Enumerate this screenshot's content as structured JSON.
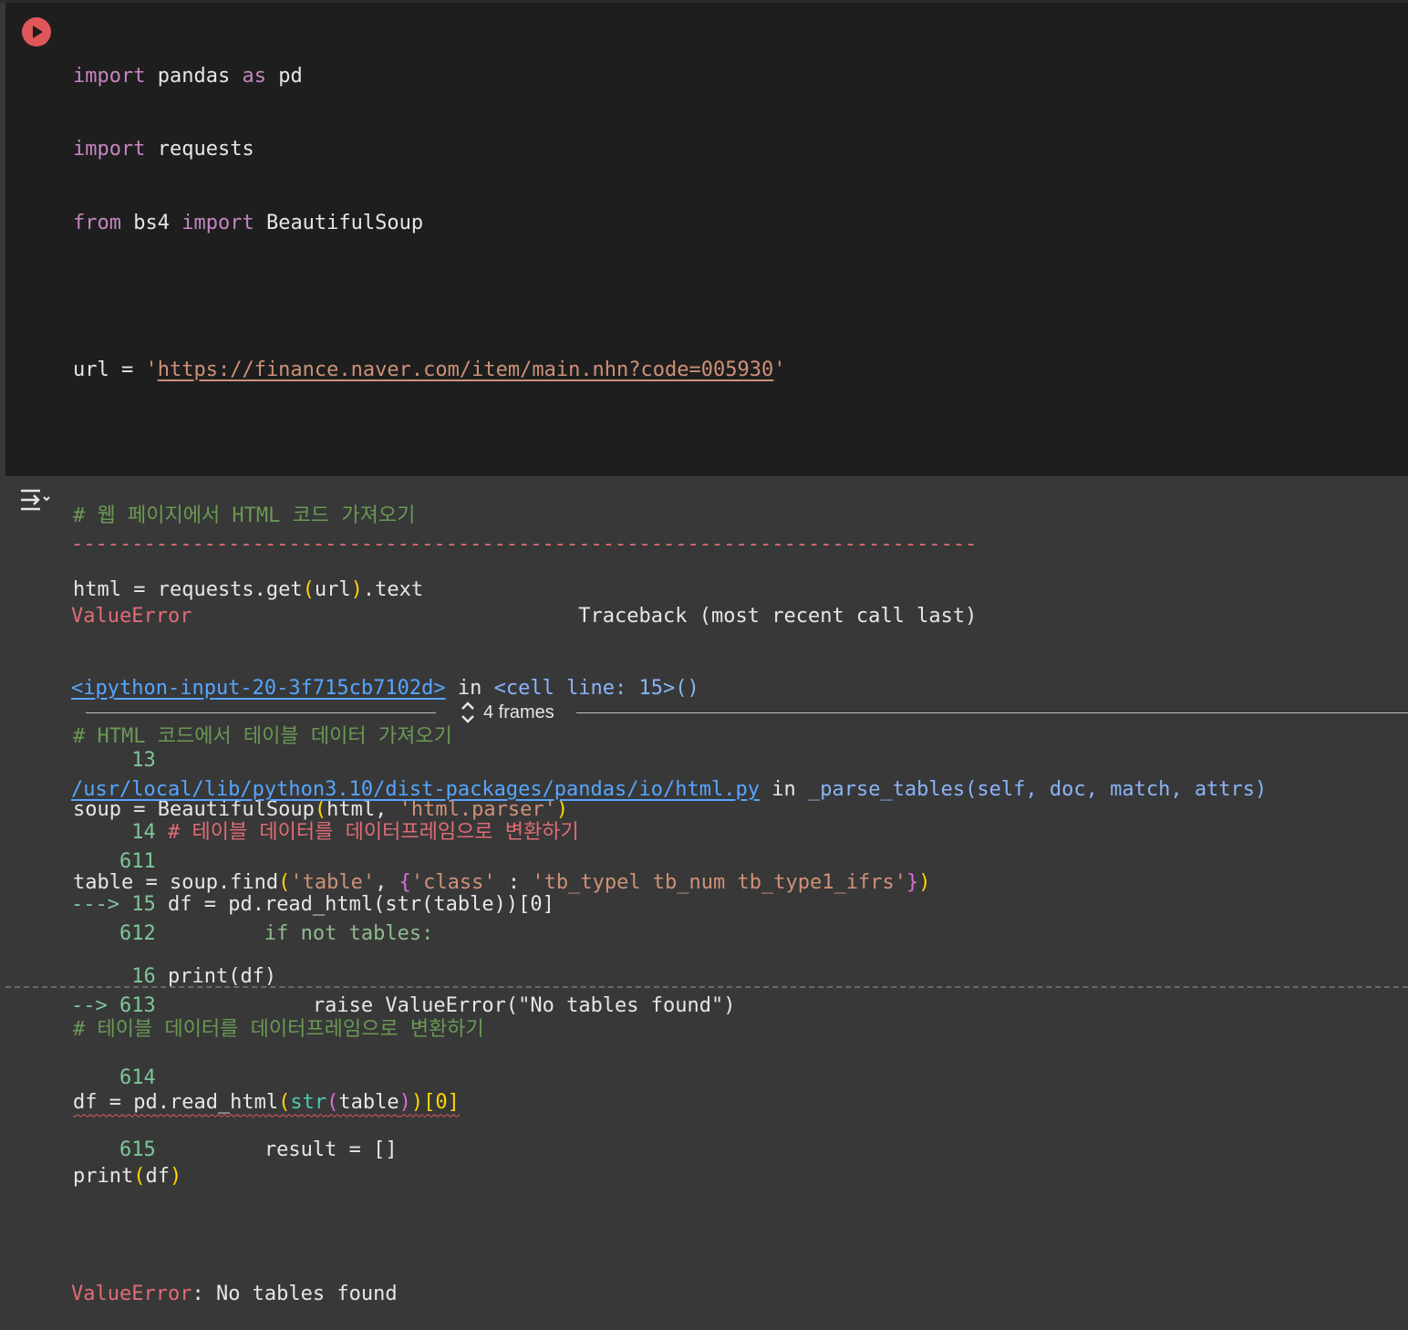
{
  "code_cell": {
    "run_button": "run-cell-icon",
    "lines": {
      "l1_kw": "import",
      "l1_rest": " pandas ",
      "l1_as": "as",
      "l1_tail": " pd",
      "l2_kw": "import",
      "l2_rest": " requests",
      "l3_from": "from",
      "l3_mod": " bs4 ",
      "l3_import": "import",
      "l3_tail": " BeautifulSoup",
      "l5_head": "url = ",
      "l5_q1": "'",
      "l5_url": "https://finance.naver.com/item/main.nhn?code=005930",
      "l5_q2": "'",
      "l7_comment": "# 웹 페이지에서 HTML 코드 가져오기",
      "l8_head": "html = requests.get",
      "l8_open": "(",
      "l8_arg": "url",
      "l8_close": ")",
      "l8_tail": ".text",
      "l10_comment": "# HTML 코드에서 테이블 데이터 가져오기",
      "l11_head": "soup = BeautifulSoup",
      "l11_open": "(",
      "l11_mid": "html, ",
      "l11_str": "'html.parser'",
      "l11_close": ")",
      "l12_head": "table = soup.find",
      "l12_open": "(",
      "l12_s1": "'table'",
      "l12_comma": ", ",
      "l12_bo": "{",
      "l12_s2": "'class'",
      "l12_colon": " : ",
      "l12_s3": "'tb_typel tb_num tb_type1_ifrs'",
      "l12_bc": "}",
      "l12_close": ")",
      "l14_comment": "# 테이블 데이터를 데이터프레임으로 변환하기",
      "l15_head": "df = pd.read_html",
      "l15_o1": "(",
      "l15_str": "str",
      "l15_o2": "(",
      "l15_arg": "table",
      "l15_c2": ")",
      "l15_c1": ")",
      "l15_idx": "[0]",
      "l16_head": "print",
      "l16_open": "(",
      "l16_arg": "df",
      "l16_close": ")"
    }
  },
  "output": {
    "icon": "output-toggle-icon",
    "dashes": "---------------------------------------------------------------------------",
    "error_name": "ValueError",
    "traceback_header": "Traceback (most recent call last)",
    "frame1": {
      "link": "<ipython-input-20-3f715cb7102d>",
      "in_text": " in ",
      "location": "<cell line: 15>()",
      "lines": [
        {
          "num": "     13",
          "code": ""
        },
        {
          "num": "     14",
          "code": "# 테이블 데이터를 데이터프레임으로 변환하기"
        },
        {
          "arrow": "---> ",
          "num": "15",
          "code": "df = pd.read_html(str(table))[0]"
        },
        {
          "num": "     16",
          "code": "print(df)"
        }
      ]
    },
    "frames_label": "4 frames",
    "frame2": {
      "link": "/usr/local/lib/python3.10/dist-packages/pandas/io/html.py",
      "in_text": " in ",
      "func": "_parse_tables(self, doc, match, attrs)",
      "lines": [
        {
          "num": "    611",
          "code": ""
        },
        {
          "num": "    612",
          "code": "        if not tables:"
        },
        {
          "arrow": "--> ",
          "num": "613",
          "code": "            raise ValueError(\"No tables found\")"
        },
        {
          "num": "    614",
          "code": ""
        },
        {
          "num": "    615",
          "code": "        result = []"
        }
      ]
    },
    "final_error_name": "ValueError",
    "final_error_msg": ": No tables found"
  },
  "colors": {
    "code_bg": "#1e1e1e",
    "output_bg": "#383838",
    "keyword": "#c586c0",
    "string": "#ce9178",
    "comment": "#6a9955",
    "error": "#e06c75",
    "link": "#56a5ff",
    "run_button": "#e0565b"
  }
}
